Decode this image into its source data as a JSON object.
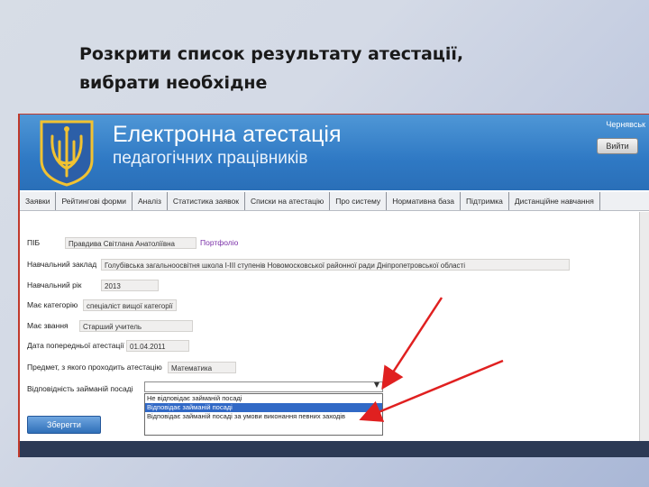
{
  "slide": {
    "title_line1": "Розкрити список  результату атестації,",
    "title_line2": "вибрати необхідне"
  },
  "header": {
    "title": "Електронна атестація",
    "subtitle": "педагогічних працівників",
    "user_name": "Чернявськ",
    "logout_label": "Вийти"
  },
  "nav": {
    "items": [
      "Заявки",
      "Рейтингові форми",
      "Аналіз",
      "Статистика заявок",
      "Списки на атестацію",
      "Про систему",
      "Нормативна база",
      "Підтримка",
      "Дистанційне навчання"
    ]
  },
  "form": {
    "pib_label": "ПІБ",
    "pib_value": "Правдива Світлана Анатоліївна",
    "portfolio_link": "Портфоліо",
    "school_label": "Навчальний заклад",
    "school_value": "Голубівська загальноосвітня школа І-ІІІ ступенів Новомосковської районної ради Дніпропетровської області",
    "year_label": "Навчальний рік",
    "year_value": "2013",
    "category_label": "Має категорію",
    "category_value": "спеціаліст вищої категорії",
    "title_label": "Має звання",
    "title_value": "Старший учитель",
    "date_label": "Дата попередньої атестації",
    "date_value": "01.04.2011",
    "subject_label": "Предмет, з якого проходить атестацію",
    "subject_value": "Математика",
    "position_label": "Відповідність займаній посаді",
    "position_value": "",
    "options": [
      "Не відповідає займаній посаді",
      "Відповідає займаній посаді",
      "Відповідає займаній посаді за умови виконання певних заходів"
    ],
    "selected_option_index": 1,
    "save_label": "Зберегти"
  },
  "colors": {
    "banner": "#2f79c4",
    "arrow": "#e02020",
    "selected_option": "#3169c6",
    "frame": "#c0392b"
  }
}
